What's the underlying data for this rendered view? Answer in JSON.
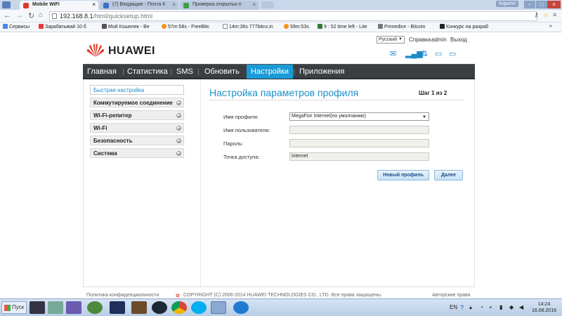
{
  "browser": {
    "tabs": [
      {
        "title": "Mobile WiFi",
        "active": true,
        "color": "#e0392b"
      },
      {
        "title": "(7) Входящие - Почта К",
        "active": false,
        "color": "#3a6ec1"
      },
      {
        "title": "Проверка открытых п",
        "active": false,
        "color": "#3d9d45"
      }
    ],
    "user": "Кирилл",
    "url_host": "192.168.8.1",
    "url_path": "/html/quicksetup.html",
    "bookmarks": [
      {
        "label": "Сервисы",
        "color": "#4a86e8"
      },
      {
        "label": "Зарабатывай 10 б",
        "color": "#e53935"
      },
      {
        "label": "Мой Кошелек - Be",
        "color": "#555555"
      },
      {
        "label": "57m:58s - FreeBitc",
        "color": "#f7931a"
      },
      {
        "label": "14m:36s 777bitco.in",
        "color": "#777777"
      },
      {
        "label": "59m:53s",
        "color": "#f7931a"
      },
      {
        "label": "9 : 52 time left - Lite",
        "color": "#2e7d32"
      },
      {
        "label": "Primedice - Bitcoin",
        "color": "#777777"
      },
      {
        "label": "Конкурс на разраб",
        "color": "#222222"
      }
    ]
  },
  "app": {
    "brand": "HUAWEI",
    "brand_color": "#e0392b",
    "language": "Русский",
    "top_links": [
      "Справка",
      "admin",
      "Выход"
    ],
    "nav": [
      {
        "label": "Главная",
        "active": false
      },
      {
        "label": "Статистика",
        "active": false
      },
      {
        "label": "SMS",
        "active": false
      },
      {
        "label": "Обновить",
        "active": false
      },
      {
        "label": "Настройки",
        "active": true
      },
      {
        "label": "Приложения",
        "active": false
      }
    ],
    "sidebar": [
      {
        "label": "Быстрая настройка",
        "active": true,
        "arrow": false
      },
      {
        "label": "Коммутируемое соединение",
        "active": false,
        "arrow": true
      },
      {
        "label": "Wi-Fi-репитер",
        "active": false,
        "arrow": true
      },
      {
        "label": "Wi-Fi",
        "active": false,
        "arrow": true
      },
      {
        "label": "Безопасность",
        "active": false,
        "arrow": true
      },
      {
        "label": "Система",
        "active": false,
        "arrow": true
      }
    ],
    "page_title": "Настройка параметров профиля",
    "step": "Шаг 1 из 2",
    "form": {
      "profile_label": "Имя профиля:",
      "profile_value": "MegaFon Internet(по умолчанию)",
      "username_label": "Имя пользователя:",
      "username_value": "",
      "password_label": "Пароль:",
      "password_value": "",
      "apn_label": "Точка доступа:",
      "apn_value": "internet"
    },
    "buttons": {
      "new_profile": "Новый профиль",
      "next": "Далее"
    },
    "footer": {
      "privacy": "Политика конфиденциальности",
      "copyright": "COPYRIGHT (C) 2006-2014 HUAWEI TECHNOLOGIES CO., LTD. Все права защищены.",
      "rights": "Авторские права"
    }
  },
  "taskbar": {
    "start_label": "Пуск",
    "lang": "EN",
    "time": "14:24",
    "date": "16.08.2016"
  }
}
